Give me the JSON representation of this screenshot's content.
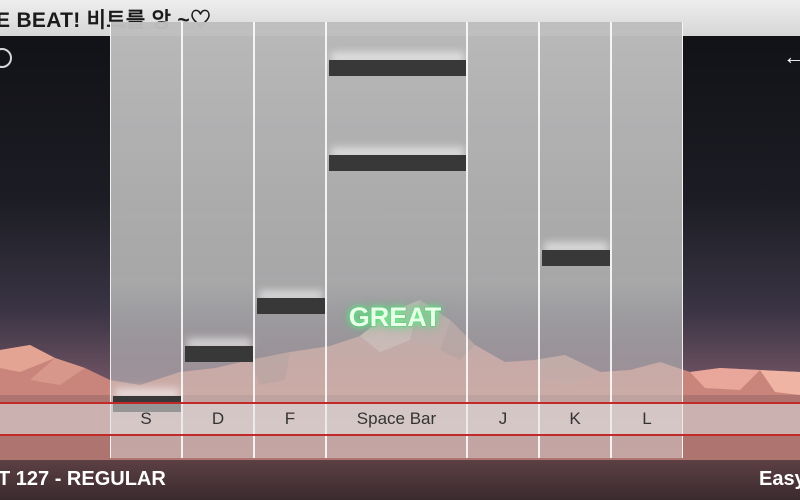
{
  "header": {
    "song_title": "E BEAT! 비트를 앙 ~♡"
  },
  "lanes": [
    {
      "key": "S"
    },
    {
      "key": "D"
    },
    {
      "key": "F"
    },
    {
      "key": "Space Bar"
    },
    {
      "key": "J"
    },
    {
      "key": "K"
    },
    {
      "key": "L"
    }
  ],
  "judgement": "GREAT",
  "footer": {
    "bpm_mode": "T 127 - REGULAR",
    "difficulty": "Easy"
  },
  "icons": {
    "back": "back-arrow-icon"
  },
  "colors": {
    "judge_line": "#c22a2a",
    "note": "#383838",
    "judgement_glow": "#7aff9a"
  }
}
